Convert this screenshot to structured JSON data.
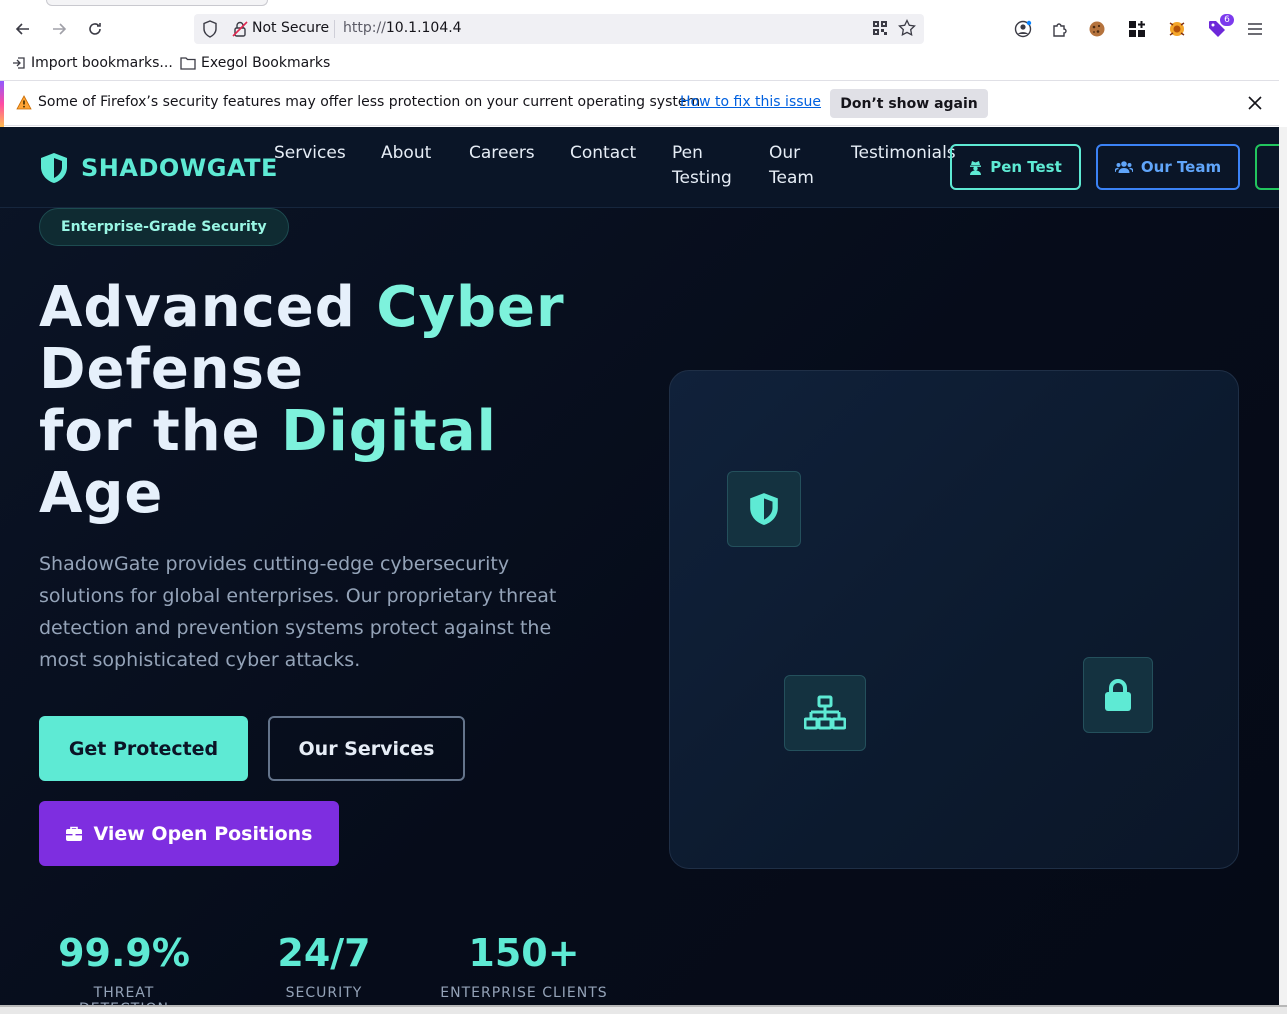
{
  "browser": {
    "security_label": "Not Secure",
    "url_prefix": "http://",
    "url_host": "10.1.104.4",
    "extension_badge": "6"
  },
  "bookmarks": [
    {
      "label": "Import bookmarks..."
    },
    {
      "label": "Exegol Bookmarks"
    }
  ],
  "notice": {
    "message": "Some of Firefox’s security features may offer less protection on your current operating system.",
    "link": "How to fix this issue",
    "button": "Don’t show again"
  },
  "site": {
    "brand": "SHADOWGATE",
    "nav": {
      "links": [
        "Services",
        "About",
        "Careers",
        "Contact",
        "Pen Testing",
        "Our Team",
        "Testimonials"
      ],
      "pentest_button": "Pen Test",
      "team_button": "Our Team"
    },
    "hero": {
      "pill": "Enterprise-Grade Security",
      "headline": {
        "line1_a": "Advanced ",
        "line1_b": "Cyber",
        "line2": "Defense",
        "line3_a": "for the ",
        "line3_b": "Digital",
        "line4": "Age"
      },
      "lead": "ShadowGate provides cutting-edge cybersecurity solutions for global enterprises. Our proprietary threat detection and prevention systems protect against the most sophisticated cyber attacks.",
      "cta_primary": "Get Protected",
      "cta_secondary": "Our Services",
      "cta_careers": "View Open Positions"
    },
    "stats": [
      {
        "value": "99.9%",
        "label": "THREAT DETECTION"
      },
      {
        "value": "24/7",
        "label": "SECURITY"
      },
      {
        "value": "150+",
        "label": "ENTERPRISE CLIENTS"
      }
    ],
    "visual_icons": [
      "shield-icon",
      "network-icon",
      "lock-icon"
    ],
    "colors": {
      "accent": "#5eead4",
      "purple": "#7e2ee0",
      "blue": "#3b82f6",
      "background": "#060c1a"
    }
  }
}
